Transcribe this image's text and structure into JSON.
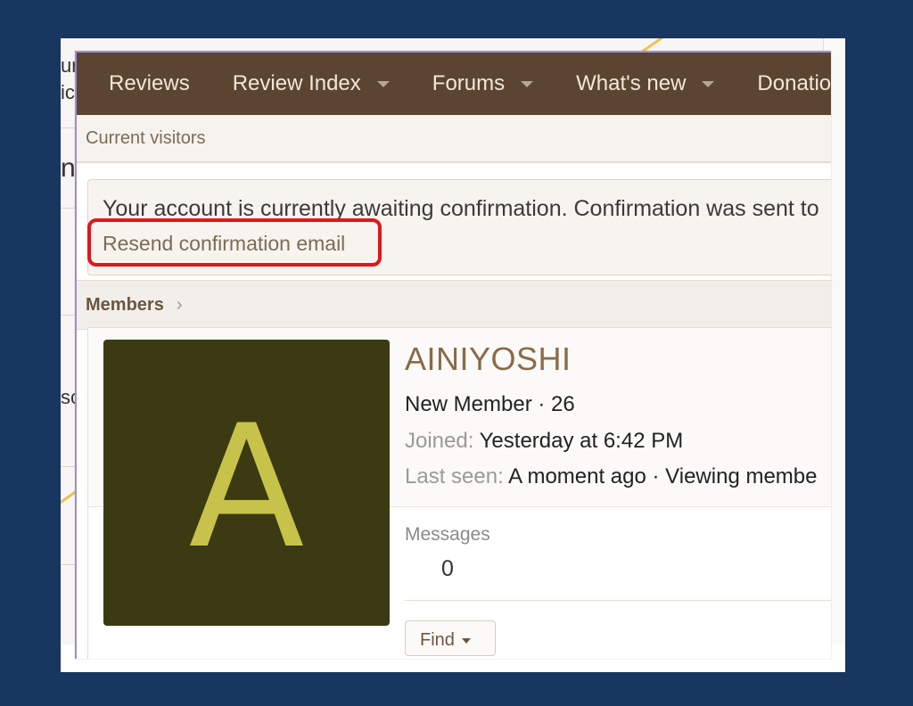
{
  "nav": {
    "items": [
      {
        "label": "Reviews",
        "has_menu": false
      },
      {
        "label": "Review Index",
        "has_menu": true
      },
      {
        "label": "Forums",
        "has_menu": true
      },
      {
        "label": "What's new",
        "has_menu": true
      },
      {
        "label": "Donatio",
        "has_menu": false
      }
    ]
  },
  "subnav": {
    "current_visitors": "Current visitors"
  },
  "notice": {
    "text": "Your account is currently awaiting confirmation. Confirmation was sent to",
    "resend_link": "Resend confirmation email"
  },
  "breadcrumb": {
    "members": "Members",
    "chevron": "›"
  },
  "profile": {
    "avatar_letter": "A",
    "username": "AINIYOSHI",
    "title_line": "New Member · 26",
    "joined_label": "Joined:",
    "joined_value": "Yesterday at 6:42 PM",
    "last_seen_label": "Last seen:",
    "last_seen_value": "A moment ago · Viewing membe",
    "messages_label": "Messages",
    "messages_value": "0",
    "find_button": "Find"
  },
  "background": {
    "edge_text_1": "ur",
    "edge_text_2": "ic",
    "edge_text_3": "n",
    "edge_text_4": "sc"
  },
  "colors": {
    "page_background": "#173660",
    "navbar": "#5b4530",
    "nav_text": "#f1e7da",
    "link": "#7d6b56",
    "username": "#8b6a48",
    "avatar_bg": "#3b3a12",
    "avatar_letter": "#c7c34a",
    "highlight_box": "#e0161c"
  }
}
